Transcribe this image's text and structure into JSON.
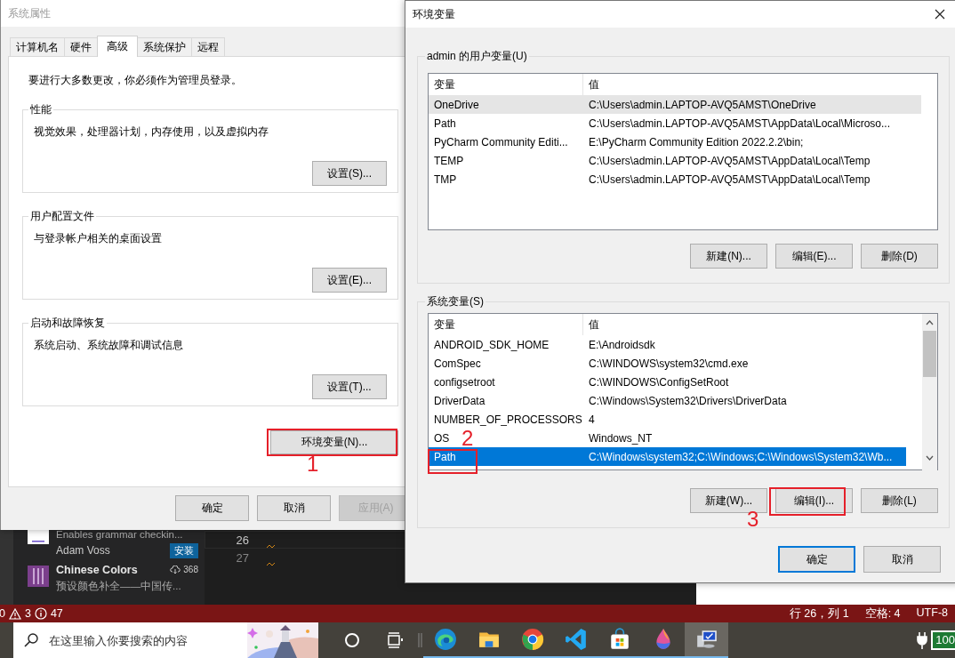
{
  "system_properties": {
    "title": "系统属性",
    "active": false,
    "tabs": [
      {
        "label": "计算机名",
        "selected": false
      },
      {
        "label": "硬件",
        "selected": false
      },
      {
        "label": "高级",
        "selected": true
      },
      {
        "label": "系统保护",
        "selected": false
      },
      {
        "label": "远程",
        "selected": false
      }
    ],
    "notice": "要进行大多数更改，你必须作为管理员登录。",
    "groups": [
      {
        "title": "性能",
        "description": "视觉效果，处理器计划，内存使用，以及虚拟内存",
        "button": "设置(S)..."
      },
      {
        "title": "用户配置文件",
        "description": "与登录帐户相关的桌面设置",
        "button": "设置(E)..."
      },
      {
        "title": "启动和故障恢复",
        "description": "系统启动、系统故障和调试信息",
        "button": "设置(T)..."
      }
    ],
    "env_button": "环境变量(N)...",
    "buttons": [
      {
        "label": "确定",
        "disabled": false
      },
      {
        "label": "取消",
        "disabled": false
      },
      {
        "label": "应用(A)",
        "disabled": true
      }
    ]
  },
  "environment_variables": {
    "title": "环境变量",
    "active": true,
    "user_vars": {
      "title": "admin 的用户变量(U)",
      "focused": false,
      "columns": [
        "变量",
        "值"
      ],
      "rows": [
        {
          "name": "OneDrive",
          "value": "C:\\Users\\admin.LAPTOP-AVQ5AMST\\OneDrive",
          "selected": true
        },
        {
          "name": "Path",
          "value": "C:\\Users\\admin.LAPTOP-AVQ5AMST\\AppData\\Local\\Microso...",
          "selected": false
        },
        {
          "name": "PyCharm Community Editi...",
          "value": "E:\\PyCharm Community Edition 2022.2.2\\bin;",
          "selected": false
        },
        {
          "name": "TEMP",
          "value": "C:\\Users\\admin.LAPTOP-AVQ5AMST\\AppData\\Local\\Temp",
          "selected": false
        },
        {
          "name": "TMP",
          "value": "C:\\Users\\admin.LAPTOP-AVQ5AMST\\AppData\\Local\\Temp",
          "selected": false
        }
      ],
      "buttons": [
        "新建(N)...",
        "编辑(E)...",
        "删除(D)"
      ]
    },
    "system_vars": {
      "title": "系统变量(S)",
      "focused": true,
      "columns": [
        "变量",
        "值"
      ],
      "rows": [
        {
          "name": "ANDROID_SDK_HOME",
          "value": "E:\\Androidsdk",
          "selected": false
        },
        {
          "name": "ComSpec",
          "value": "C:\\WINDOWS\\system32\\cmd.exe",
          "selected": false
        },
        {
          "name": "configsetroot",
          "value": "C:\\WINDOWS\\ConfigSetRoot",
          "selected": false
        },
        {
          "name": "DriverData",
          "value": "C:\\Windows\\System32\\Drivers\\DriverData",
          "selected": false
        },
        {
          "name": "NUMBER_OF_PROCESSORS",
          "value": "4",
          "selected": false
        },
        {
          "name": "OS",
          "value": "Windows_NT",
          "selected": false
        },
        {
          "name": "Path",
          "value": "C:\\Windows\\system32;C:\\Windows;C:\\Windows\\System32\\Wb...",
          "selected": true
        }
      ],
      "buttons": [
        "新建(W)...",
        "编辑(I)...",
        "删除(L)"
      ]
    },
    "buttons": [
      {
        "label": "确定",
        "default": true
      },
      {
        "label": "取消",
        "default": false
      }
    ]
  },
  "annotations": [
    {
      "label": "1"
    },
    {
      "label": "2"
    },
    {
      "label": "3"
    }
  ],
  "editor": {
    "extensions": [
      {
        "description": "Enables grammar checkin...",
        "author": "Adam Voss",
        "install_button": "安装"
      },
      {
        "name": "Chinese Colors",
        "downloads": "368",
        "description": "预设颜色补全——中国传..."
      }
    ],
    "line_numbers": [
      {
        "number": "26",
        "current": true
      },
      {
        "number": "27",
        "current": false
      }
    ]
  },
  "status_bar": {
    "errors": "0",
    "warnings": "3",
    "infos": "47",
    "position": "行 26，列 1",
    "indent": "空格: 4",
    "encoding": "UTF-8"
  },
  "taskbar": {
    "search": {
      "placeholder": "在这里输入你要搜索的内容"
    },
    "apps": [
      {
        "kind": "edge",
        "active": false
      },
      {
        "kind": "folder",
        "active": false
      },
      {
        "kind": "chrome",
        "active": false
      },
      {
        "kind": "code",
        "active": false
      },
      {
        "kind": "store",
        "active": false
      },
      {
        "kind": "paint",
        "active": false
      },
      {
        "kind": "system",
        "active": true
      }
    ],
    "battery": "100"
  }
}
